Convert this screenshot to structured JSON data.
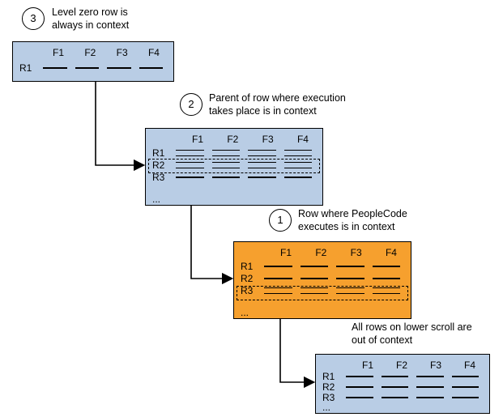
{
  "bubbles": {
    "b3": "3",
    "b2": "2",
    "b1": "1"
  },
  "captions": {
    "c3": "Level zero row is\nalways in context",
    "c2": "Parent of row where execution\ntakes place is in context",
    "c1": "Row where PeopleCode\nexecutes is in context",
    "c4": "All rows on lower scroll are\nout of context"
  },
  "tables": {
    "level0": {
      "headers": [
        "F1",
        "F2",
        "F3",
        "F4"
      ],
      "rows": [
        "R1"
      ],
      "ellipsis": ""
    },
    "level1": {
      "headers": [
        "F1",
        "F2",
        "F3",
        "F4"
      ],
      "rows": [
        "R1",
        "R2",
        "R3"
      ],
      "ellipsis": "..."
    },
    "level2": {
      "headers": [
        "F1",
        "F2",
        "F3",
        "F4"
      ],
      "rows": [
        "R1",
        "R2",
        "R3"
      ],
      "ellipsis": "..."
    },
    "level3": {
      "headers": [
        "F1",
        "F2",
        "F3",
        "F4"
      ],
      "rows": [
        "R1",
        "R2",
        "R3"
      ],
      "ellipsis": "..."
    }
  },
  "chart_data": {
    "type": "table",
    "title": "PeopleCode data buffer context levels",
    "levels": [
      {
        "level": 0,
        "label": "Level zero row is always in context",
        "fields": [
          "F1",
          "F2",
          "F3",
          "F4"
        ],
        "rows": [
          "R1"
        ],
        "selected_row": null,
        "in_context": true,
        "ellipsis": false
      },
      {
        "level": 1,
        "label": "Parent of row where execution takes place is in context",
        "fields": [
          "F1",
          "F2",
          "F3",
          "F4"
        ],
        "rows": [
          "R1",
          "R2",
          "R3"
        ],
        "selected_row": "R2",
        "in_context": true,
        "ellipsis": true
      },
      {
        "level": 2,
        "label": "Row where PeopleCode executes is in context",
        "fields": [
          "F1",
          "F2",
          "F3",
          "F4"
        ],
        "rows": [
          "R1",
          "R2",
          "R3"
        ],
        "selected_row": "R3",
        "in_context": true,
        "ellipsis": true,
        "highlight": true
      },
      {
        "level": 3,
        "label": "All rows on lower scroll are out of context",
        "fields": [
          "F1",
          "F2",
          "F3",
          "F4"
        ],
        "rows": [
          "R1",
          "R2",
          "R3"
        ],
        "selected_row": null,
        "in_context": false,
        "ellipsis": true
      }
    ]
  }
}
